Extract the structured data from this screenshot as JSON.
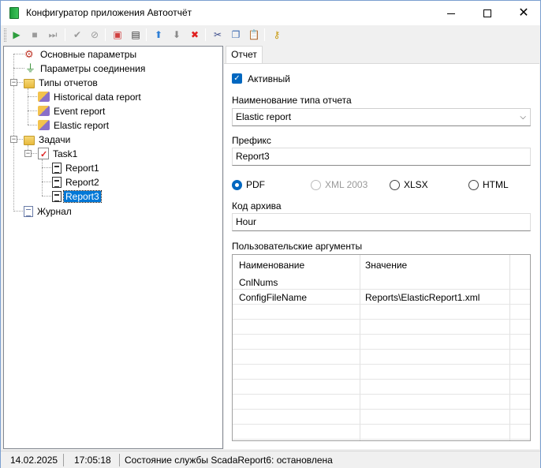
{
  "window": {
    "title": "Конфигуратор приложения Автоотчёт",
    "minimize_icon": "minimize-icon",
    "maximize_icon": "maximize-icon",
    "close_icon": "close-icon"
  },
  "toolbar": {
    "buttons": [
      {
        "name": "start-icon",
        "glyph": "▶",
        "color": "#2e9e3e"
      },
      {
        "name": "stop-icon",
        "glyph": "■",
        "color": "#9a9a9a"
      },
      {
        "name": "restart-icon",
        "glyph": "⏭",
        "color": "#9a9a9a"
      },
      {
        "name": "apply-icon",
        "glyph": "✔",
        "color": "#9a9a9a"
      },
      {
        "name": "cancel-icon",
        "glyph": "⊘",
        "color": "#9a9a9a"
      },
      {
        "name": "add-task-icon",
        "glyph": "▣",
        "color": "#d04040"
      },
      {
        "name": "add-report-icon",
        "glyph": "▤",
        "color": "#333333"
      },
      {
        "name": "move-up-icon",
        "glyph": "⬆",
        "color": "#2f7fd6"
      },
      {
        "name": "move-down-icon",
        "glyph": "⬇",
        "color": "#8a8a8a"
      },
      {
        "name": "delete-icon",
        "glyph": "✖",
        "color": "#e02020"
      },
      {
        "name": "cut-icon",
        "glyph": "✂",
        "color": "#3a4a8a"
      },
      {
        "name": "copy-icon",
        "glyph": "❐",
        "color": "#3a6ab0"
      },
      {
        "name": "paste-icon",
        "glyph": "📋",
        "color": "#888888"
      },
      {
        "name": "key-icon",
        "glyph": "⚷",
        "color": "#c89a10"
      }
    ]
  },
  "tree": {
    "items": [
      {
        "label": "Основные параметры",
        "icon": "settings-icon"
      },
      {
        "label": "Параметры соединения",
        "icon": "plug-icon"
      },
      {
        "label": "Типы отчетов",
        "icon": "folder-icon"
      },
      {
        "label": "Historical data report",
        "icon": "report-type-icon"
      },
      {
        "label": "Event report",
        "icon": "report-type-icon"
      },
      {
        "label": "Elastic report",
        "icon": "report-type-icon"
      },
      {
        "label": "Задачи",
        "icon": "folder-icon"
      },
      {
        "label": "Task1",
        "icon": "task-icon"
      },
      {
        "label": "Report1",
        "icon": "report-icon"
      },
      {
        "label": "Report2",
        "icon": "report-icon"
      },
      {
        "label": "Report3",
        "icon": "report-icon",
        "selected": true
      },
      {
        "label": "Журнал",
        "icon": "journal-icon"
      }
    ]
  },
  "tabs": [
    {
      "label": "Отчет",
      "active": true
    }
  ],
  "form": {
    "active_label": "Активный",
    "active_checked": true,
    "report_type_label": "Наименование типа отчета",
    "report_type_value": "Elastic report",
    "prefix_label": "Префикс",
    "prefix_value": "Report3",
    "formats": [
      {
        "label": "PDF",
        "checked": true,
        "enabled": true
      },
      {
        "label": "XML 2003",
        "checked": false,
        "enabled": false
      },
      {
        "label": "XLSX",
        "checked": false,
        "enabled": true
      },
      {
        "label": "HTML",
        "checked": false,
        "enabled": true
      }
    ],
    "archive_code_label": "Код архива",
    "archive_code_value": "Hour",
    "custom_args_label": "Пользовательские аргументы",
    "args_grid": {
      "columns": [
        "Наименование",
        "Значение"
      ],
      "rows": [
        [
          "CnlNums",
          ""
        ],
        [
          "ConfigFileName",
          "Reports\\ElasticReport1.xml"
        ]
      ]
    }
  },
  "status": {
    "date": "14.02.2025",
    "time": "17:05:18",
    "service_state": "Состояние службы ScadaReport6: остановлена"
  },
  "colors": {
    "accent": "#0067c0",
    "selection": "#0078d7"
  }
}
